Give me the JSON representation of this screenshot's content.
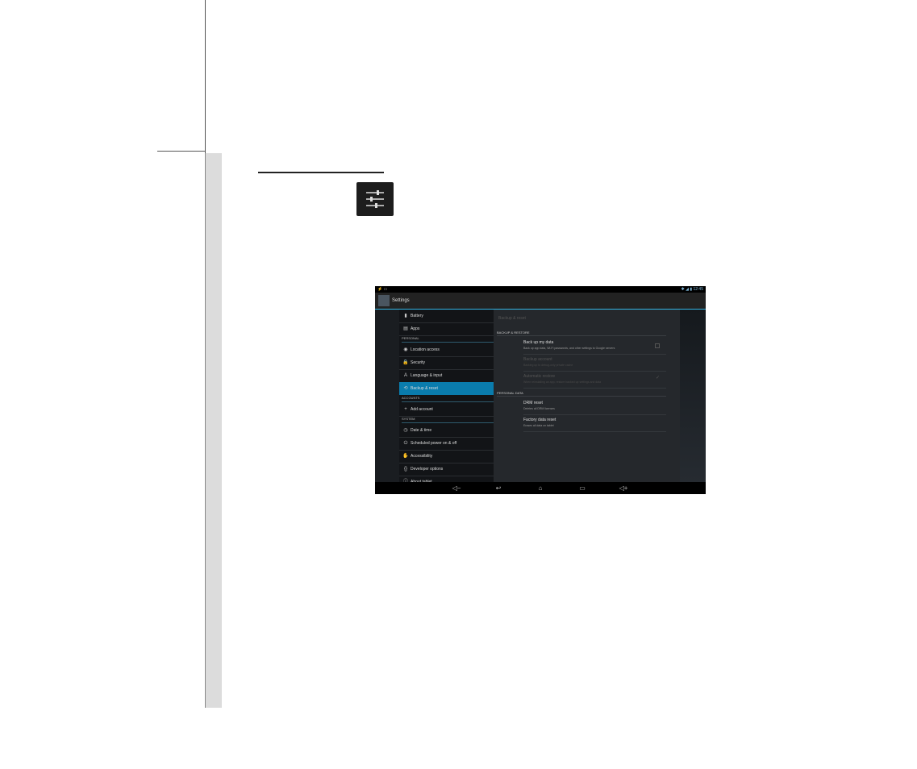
{
  "app": {
    "title": "Settings",
    "status_time": "12:45",
    "status_left": "⚡ ▭",
    "status_right_icons": "✱ ◢ ▮"
  },
  "sidebar": {
    "items": [
      {
        "icon": "battery-icon",
        "glyph": "▮",
        "label": "Battery"
      },
      {
        "icon": "apps-icon",
        "glyph": "▤",
        "label": "Apps"
      },
      {
        "header": "PERSONAL"
      },
      {
        "icon": "location-icon",
        "glyph": "◉",
        "label": "Location access"
      },
      {
        "icon": "lock-icon",
        "glyph": "🔒",
        "label": "Security"
      },
      {
        "icon": "keyboard-icon",
        "glyph": "A",
        "label": "Language & input"
      },
      {
        "icon": "backup-icon",
        "glyph": "⟲",
        "label": "Backup & reset",
        "active": true
      },
      {
        "header": "ACCOUNTS"
      },
      {
        "icon": "plus-icon",
        "glyph": "+",
        "label": "Add account"
      },
      {
        "header": "SYSTEM"
      },
      {
        "icon": "clock-icon",
        "glyph": "◷",
        "label": "Date & time"
      },
      {
        "icon": "power-icon",
        "glyph": "⏻",
        "label": "Scheduled power on & off"
      },
      {
        "icon": "hand-icon",
        "glyph": "✋",
        "label": "Accessibility"
      },
      {
        "icon": "braces-icon",
        "glyph": "{}",
        "label": "Developer options"
      },
      {
        "icon": "info-icon",
        "glyph": "ⓘ",
        "label": "About tablet"
      }
    ]
  },
  "detail": {
    "title": "Backup & reset",
    "sections": [
      {
        "header": "BACKUP & RESTORE",
        "prefs": [
          {
            "title": "Back up my data",
            "summary": "Back up app data, Wi-Fi passwords, and other settings to Google servers",
            "control": "checkbox",
            "disabled": false
          },
          {
            "title": "Backup account",
            "summary": "Backing up to debug-only private cache",
            "control": "none",
            "disabled": true
          },
          {
            "title": "Automatic restore",
            "summary": "When reinstalling an app, restore backed up settings and data",
            "control": "check",
            "disabled": true
          }
        ]
      },
      {
        "header": "PERSONAL DATA",
        "prefs": [
          {
            "title": "DRM reset",
            "summary": "Deletes all DRM licenses",
            "control": "none",
            "disabled": false
          },
          {
            "title": "Factory data reset",
            "summary": "Erases all data on tablet",
            "control": "none",
            "disabled": false
          }
        ]
      }
    ]
  },
  "navbar": {
    "buttons": [
      {
        "name": "volume-down-button",
        "glyph": "◁−"
      },
      {
        "name": "back-button",
        "glyph": "↩"
      },
      {
        "name": "home-button",
        "glyph": "⌂"
      },
      {
        "name": "recent-apps-button",
        "glyph": "▭"
      },
      {
        "name": "volume-up-button",
        "glyph": "◁+"
      }
    ]
  },
  "colors": {
    "accent": "#33b5e5",
    "active_item": "#0a7cad"
  }
}
